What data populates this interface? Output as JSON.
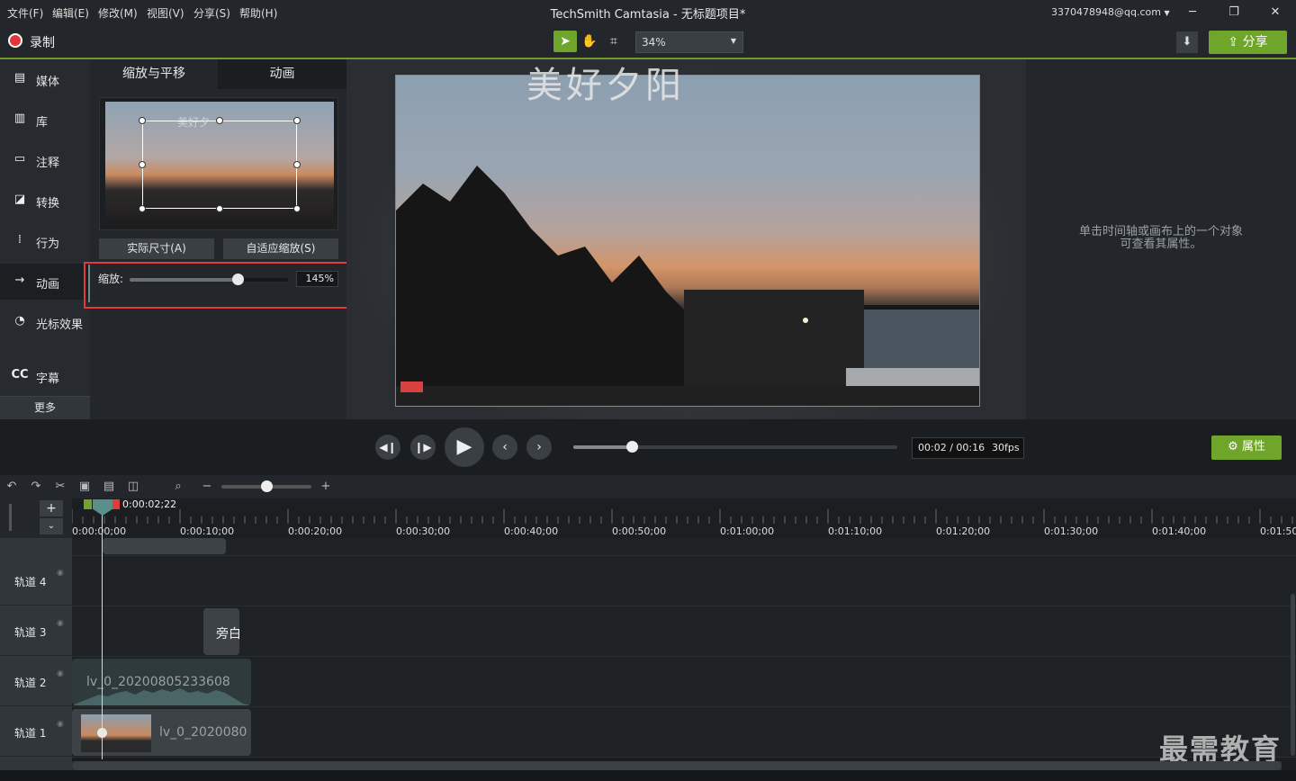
{
  "menu": [
    "文件(F)",
    "编辑(E)",
    "修改(M)",
    "视图(V)",
    "分享(S)",
    "帮助(H)"
  ],
  "app_title": "TechSmith Camtasia - 无标题项目*",
  "account": "3370478948@qq.com",
  "window_controls": {
    "minimize": "─",
    "restore": "❐",
    "close": "✕"
  },
  "toolbar": {
    "record_label": "录制",
    "zoom_value": "34%",
    "share_label": "分享"
  },
  "sidebar": {
    "items": [
      {
        "label": "媒体",
        "icon": "film-icon"
      },
      {
        "label": "库",
        "icon": "library-icon"
      },
      {
        "label": "注释",
        "icon": "annotation-icon"
      },
      {
        "label": "转换",
        "icon": "transition-icon"
      },
      {
        "label": "行为",
        "icon": "behavior-icon"
      },
      {
        "label": "动画",
        "icon": "animation-icon"
      },
      {
        "label": "光标效果",
        "icon": "cursor-icon"
      },
      {
        "label": "字幕",
        "icon": "cc-icon"
      }
    ],
    "more_label": "更多"
  },
  "properties": {
    "tabs": [
      "缩放与平移",
      "动画"
    ],
    "actual_size_button": "实际尺寸(A)",
    "fit_button": "自适应缩放(S)",
    "scale_label": "缩放:",
    "scale_value": "145%",
    "scale_fraction": 0.68,
    "thumb_text": "美好夕"
  },
  "canvas": {
    "overlay_title": "美好夕阳"
  },
  "right_panel": {
    "hint_line1": "单击时间轴或画布上的一个对象",
    "hint_line2": "可查看其属性。"
  },
  "playback": {
    "time": "00:02 / 00:16",
    "fps": "30fps",
    "seek_fraction": 0.18,
    "properties_label": "属性"
  },
  "timeline": {
    "playhead_time": "0:00:02;22",
    "ticks": [
      "0:00:00;00",
      "0:00:10;00",
      "0:00:20;00",
      "0:00:30;00",
      "0:00:40;00",
      "0:00:50;00",
      "0:01:00;00",
      "0:01:10;00",
      "0:01:20;00",
      "0:01:30;00",
      "0:01:40;00",
      "0:01:50;"
    ],
    "tracks": [
      "轨道 4",
      "轨道 3",
      "轨道 2",
      "轨道 1"
    ],
    "clip_track3": "旁白",
    "clip_track2": "lv_0_20200805233608",
    "clip_track1": "lv_0_2020080",
    "zoom_fraction": 0.5
  },
  "watermark": "最需教育",
  "colors": {
    "accent": "#6fa52a",
    "record": "#e3363a",
    "highlight_box": "#e33b3b"
  }
}
